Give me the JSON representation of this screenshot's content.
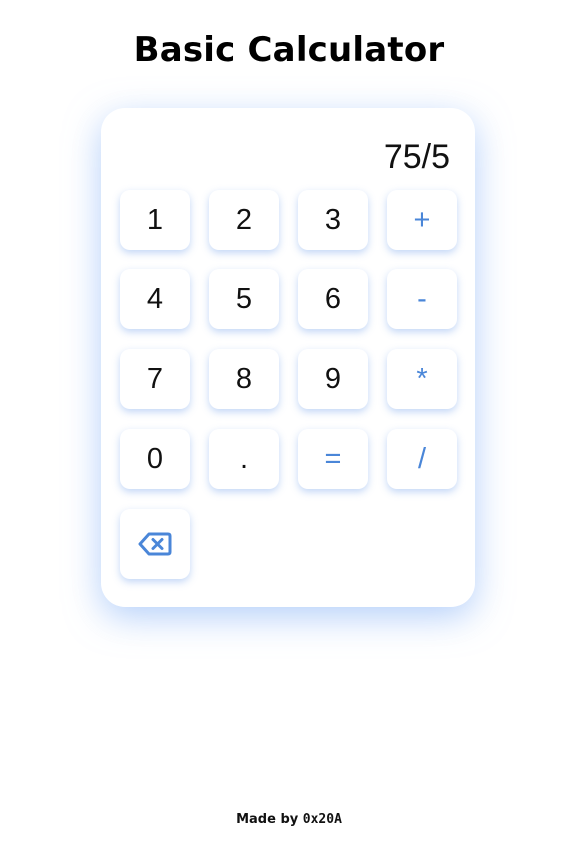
{
  "title": "Basic Calculator",
  "display": "75/5",
  "buttons": {
    "one": "1",
    "two": "2",
    "three": "3",
    "plus": "+",
    "four": "4",
    "five": "5",
    "six": "6",
    "minus": "-",
    "seven": "7",
    "eight": "8",
    "nine": "9",
    "multiply": "*",
    "zero": "0",
    "decimal": ".",
    "equals": "=",
    "divide": "/",
    "backspace_icon": "backspace-icon"
  },
  "footer": {
    "prefix": "Made by",
    "handle": "0x20A"
  },
  "colors": {
    "operator": "#4a86d8",
    "shadow": "#78aaf5"
  }
}
